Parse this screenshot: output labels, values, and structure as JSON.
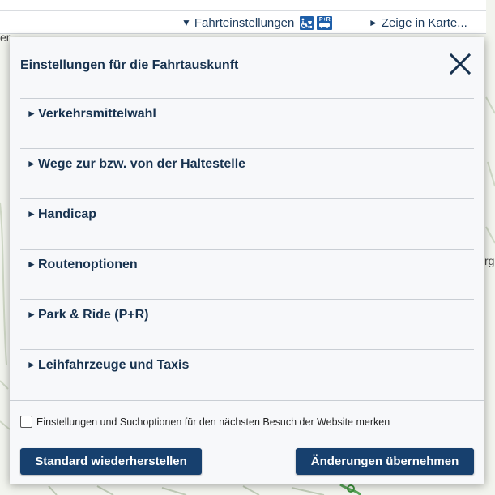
{
  "topbar": {
    "settings_label": "Fahrteinstellungen",
    "map_label": "Zeige in Karte...",
    "badge_park_ride": "P+R"
  },
  "map": {
    "label_left": "er",
    "label_right": "rg"
  },
  "dialog": {
    "title": "Einstellungen für die Fahrtauskunft",
    "sections": [
      {
        "label": "Verkehrsmittelwahl"
      },
      {
        "label": "Wege zur bzw. von der Haltestelle"
      },
      {
        "label": "Handicap"
      },
      {
        "label": "Routenoptionen"
      },
      {
        "label": "Park & Ride (P+R)"
      },
      {
        "label": "Leihfahrzeuge und Taxis"
      }
    ],
    "remember_label": "Einstellungen und Suchoptionen für den nächsten Besuch der Website merken",
    "remember_checked": false,
    "reset_button": "Standard wiederherstellen",
    "apply_button": "Änderungen übernehmen"
  },
  "colors": {
    "primary": "#17406e",
    "text": "#17324f",
    "badge": "#1f5fa9"
  },
  "icons": {
    "triangle": "triangle-right-icon",
    "close": "close-icon",
    "accessibility": "wheelchair-stroller-icon",
    "park_ride": "park-ride-icon"
  }
}
